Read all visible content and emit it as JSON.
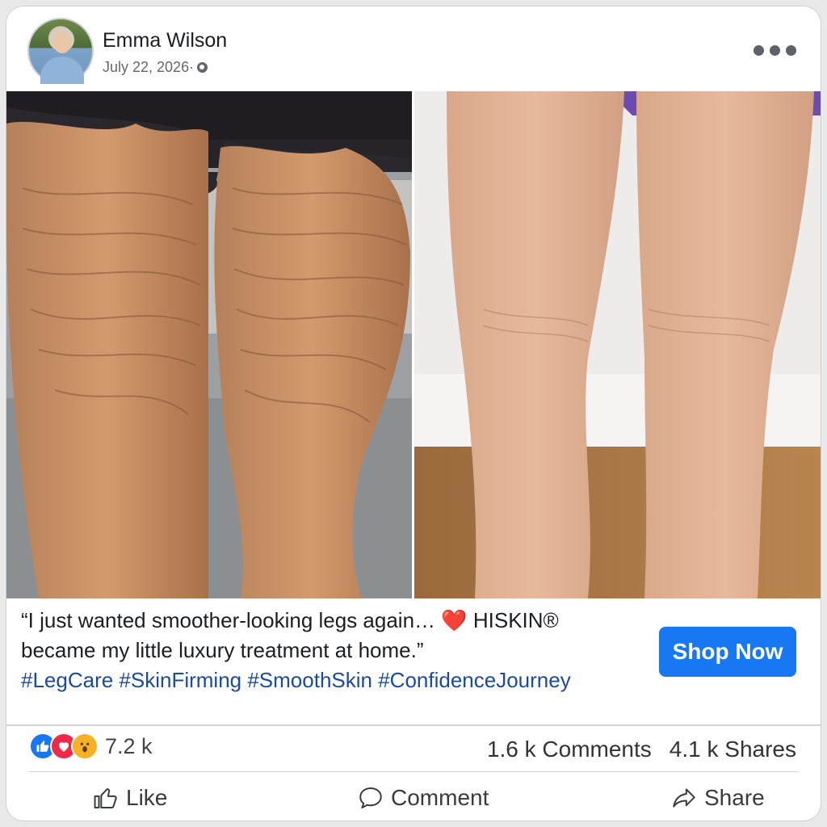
{
  "post": {
    "author": "Emma Wilson",
    "date": "July 22, 2026·",
    "quote_line1": "“I just wanted smoother-looking legs again… ❤️ HISKIN®",
    "quote_line2": "became my little luxury treatment at home.”",
    "hashtags": "#LegCare #SkinFirming #SmoothSkin #ConfidenceJourney",
    "cta_label": "Shop Now"
  },
  "stats": {
    "reactions": "7.2 k",
    "comments": "1.6 k Comments",
    "shares": "4.1 k Shares"
  },
  "actions": {
    "like": "Like",
    "comment": "Comment",
    "share": "Share"
  },
  "icons": [
    "globe-icon",
    "more-options-icon",
    "like-reaction-icon",
    "love-reaction-icon",
    "wow-reaction-icon",
    "thumbs-up-icon",
    "comment-bubble-icon",
    "share-arrow-icon"
  ],
  "colors": {
    "accent": "#1877f2",
    "hashtag": "#1b4aa0",
    "love": "#f02849",
    "wow": "#f7b125"
  }
}
